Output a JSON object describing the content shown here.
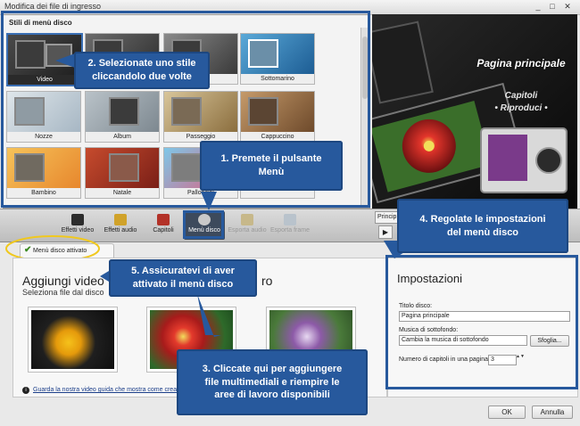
{
  "window": {
    "title": "Modifica dei file di ingresso",
    "minimize": "_",
    "maximize": "□",
    "close": "✕"
  },
  "styles_panel": {
    "header": "Stili di menù disco",
    "thumbnails": [
      "Video",
      "",
      "",
      "Sottomarino",
      "Nozze",
      "Album",
      "Passeggio",
      "Cappuccino",
      "Bambino",
      "Natale",
      "Palloncini",
      ""
    ]
  },
  "preview": {
    "title": "Pagina principale",
    "item_chapters": "Capitoli",
    "item_play": "• Riproduci •",
    "tab_partial": "Princip"
  },
  "toolbar": {
    "buttons": [
      "Effetti video",
      "Effetti audio",
      "Capitoli",
      "Menù disco",
      "Esporta audio",
      "Esporta frame"
    ]
  },
  "menu_tab": {
    "label": "Menù disco attivato",
    "checkmark": "✔"
  },
  "content": {
    "add_title": "Aggiungi video",
    "add_title_tail": "ro",
    "add_subtitle": "Seleziona file dal disco",
    "guide_link": "Guarda la nostra video guida che mostra come creare u",
    "info_icon": "i"
  },
  "settings": {
    "title": "Impostazioni",
    "disc_title_label": "Titolo disco:",
    "disc_title_value": "Pagina principale",
    "music_label": "Musica di sottofondo:",
    "music_value": "Cambia la musica di sottofondo",
    "browse_button": "Sfoglia...",
    "chapters_label": "Numero di capitoli in una pagina:",
    "chapters_value": "3",
    "spin": "▲▼"
  },
  "buttons": {
    "ok": "OK",
    "cancel": "Annulla"
  },
  "callouts": {
    "c1": "1. Premete il pulsante\nMenù",
    "c2": "2. Selezionate uno stile\ncliccandolo due volte",
    "c3": "3. Cliccate qui per aggiungere\nfile multimediali e riempire le\naree di lavoro disponibili",
    "c4": "4. Regolate le impostazioni\ndel menù disco",
    "c5": "5. Assicuratevi di aver\nattivato il menù disco"
  },
  "colors": {
    "callout": "#27599d",
    "active_tab": "#3d4a5c",
    "link": "#1c3f8a"
  }
}
